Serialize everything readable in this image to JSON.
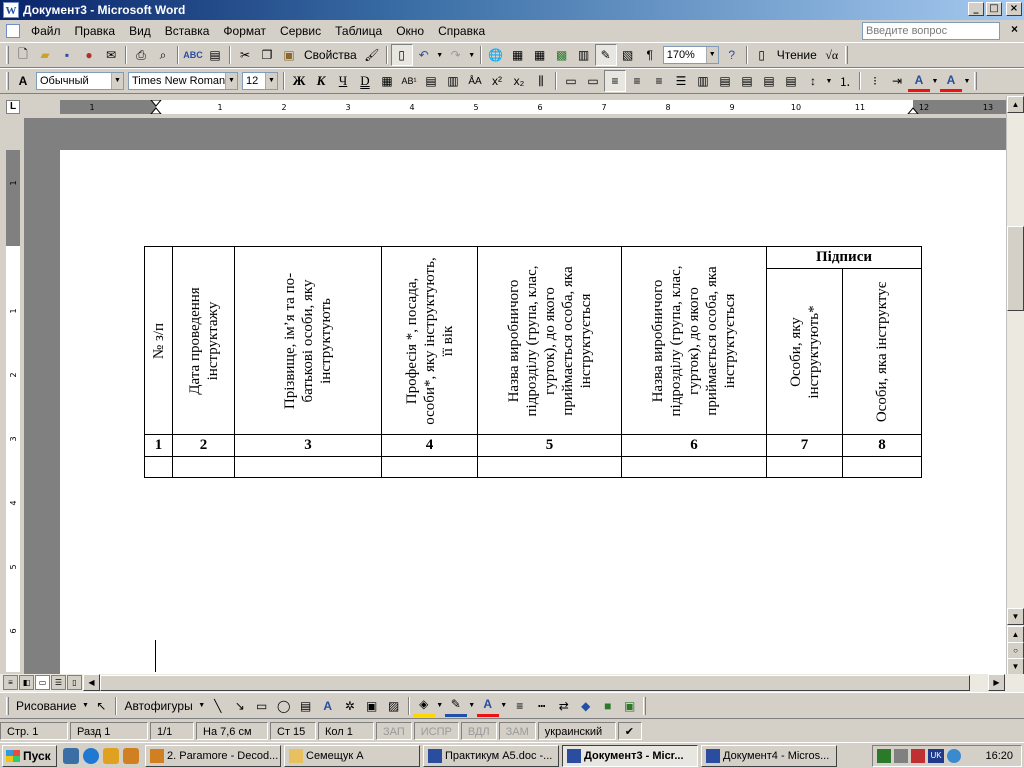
{
  "window": {
    "title": "Документ3 - Microsoft Word",
    "app_icon_letter": "W",
    "min_label": "_",
    "max_label": "□",
    "close_label": "×"
  },
  "menu": {
    "items": [
      "Файл",
      "Правка",
      "Вид",
      "Вставка",
      "Формат",
      "Сервис",
      "Таблица",
      "Окно",
      "Справка"
    ],
    "help_placeholder": "Введите вопрос",
    "close_doc": "×"
  },
  "standard_toolbar": {
    "properties_label": "Свойства",
    "zoom": "170%",
    "reading_label": "Чтение"
  },
  "format_toolbar": {
    "style": "Обычный",
    "font": "Times New Roman",
    "size": "12"
  },
  "ruler": {
    "tab_selector": "L",
    "marks": [
      "1",
      "1",
      "2",
      "3",
      "4",
      "5",
      "6",
      "7",
      "8",
      "9",
      "10",
      "11",
      "12",
      "13"
    ],
    "vmarks": [
      "1",
      "1",
      "2",
      "3",
      "4",
      "5",
      "6"
    ]
  },
  "table": {
    "headers": [
      "№ з/п",
      "Дата проведення інструктажу",
      "Прізвище, ім’я та по-батькові особи, яку інструктують",
      "Професія *, посада, особи*, яку інструктують, її вік",
      "Назва виробничого підрозділу (група, клас, гурток), до якого приймається особа, яка інструктується",
      "Назва виробничого підрозділу (група, клас, гурток), до якого приймається особа, яка інструктується",
      "Особи, яку інструктують*",
      "Особи, яка інструктує"
    ],
    "signatures_header": "Підписи",
    "numbers": [
      "1",
      "2",
      "3",
      "4",
      "5",
      "6",
      "7",
      "8"
    ]
  },
  "drawing_toolbar": {
    "draw_label": "Рисование",
    "autoshapes_label": "Автофигуры"
  },
  "status": {
    "page": "Стр. 1",
    "section": "Разд 1",
    "pages": "1/1",
    "at": "На 7,6 см",
    "line": "Ст 15",
    "col": "Кол 1",
    "rec": "ЗАП",
    "trk": "ИСПР",
    "ext": "ВДЛ",
    "ovr": "ЗАМ",
    "language": "украинский"
  },
  "taskbar": {
    "start_label": "Пуск",
    "tasks": [
      {
        "label": "2. Paramore - Decod...",
        "active": false
      },
      {
        "label": "Семещук А",
        "active": false
      },
      {
        "label": "Практикум А5.doc -...",
        "active": false
      },
      {
        "label": "Документ3 - Micr...",
        "active": true
      },
      {
        "label": "Документ4 - Micros...",
        "active": false
      }
    ],
    "lang_indicator": "UK",
    "clock": "16:20"
  },
  "colors": {
    "title_gradient_start": "#0a246a",
    "title_gradient_end": "#a6caf0",
    "chrome": "#d4d0c8",
    "doc_background": "#808080"
  }
}
